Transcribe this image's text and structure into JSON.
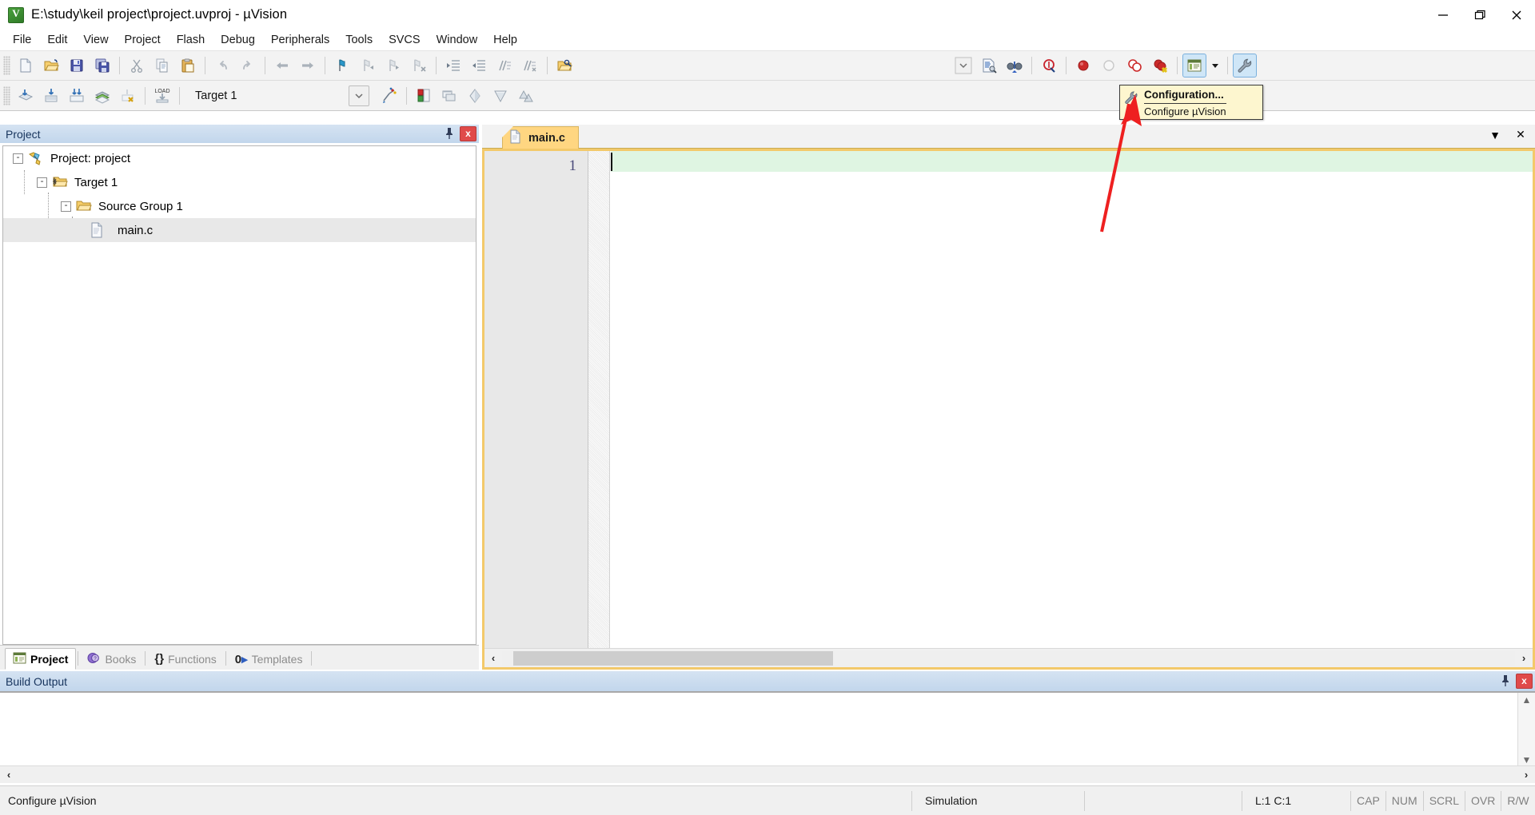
{
  "window": {
    "title": "E:\\study\\keil project\\project.uvproj - µVision",
    "app_icon": "uvision-icon",
    "controls": {
      "minimize": "minimize-icon",
      "restore": "restore-icon",
      "close": "close-icon"
    }
  },
  "menubar": {
    "items": [
      {
        "label": "File"
      },
      {
        "label": "Edit"
      },
      {
        "label": "View"
      },
      {
        "label": "Project"
      },
      {
        "label": "Flash"
      },
      {
        "label": "Debug"
      },
      {
        "label": "Peripherals"
      },
      {
        "label": "Tools"
      },
      {
        "label": "SVCS"
      },
      {
        "label": "Window"
      },
      {
        "label": "Help"
      }
    ]
  },
  "toolbar_main": {
    "buttons": [
      {
        "name": "new-file-icon",
        "tip": "New"
      },
      {
        "name": "open-file-icon",
        "tip": "Open"
      },
      {
        "name": "save-icon",
        "tip": "Save"
      },
      {
        "name": "save-all-icon",
        "tip": "Save All"
      },
      {
        "name": "cut-icon",
        "tip": "Cut"
      },
      {
        "name": "copy-icon",
        "tip": "Copy"
      },
      {
        "name": "paste-icon",
        "tip": "Paste"
      },
      {
        "name": "undo-icon",
        "tip": "Undo"
      },
      {
        "name": "redo-icon",
        "tip": "Redo"
      },
      {
        "name": "navigate-back-icon",
        "tip": "Back"
      },
      {
        "name": "navigate-forward-icon",
        "tip": "Forward"
      },
      {
        "name": "bookmark-toggle-icon",
        "tip": "Insert/Remove Bookmark"
      },
      {
        "name": "bookmark-prev-icon",
        "tip": "Previous Bookmark"
      },
      {
        "name": "bookmark-next-icon",
        "tip": "Next Bookmark"
      },
      {
        "name": "bookmark-clear-icon",
        "tip": "Clear All Bookmarks"
      },
      {
        "name": "indent-icon",
        "tip": "Indent"
      },
      {
        "name": "outdent-icon",
        "tip": "Outdent"
      },
      {
        "name": "comment-icon",
        "tip": "Comment"
      },
      {
        "name": "uncomment-icon",
        "tip": "Uncomment"
      },
      {
        "name": "open-folder-search-icon",
        "tip": "Find in Files"
      },
      {
        "name": "search-history-dropdown-icon",
        "tip": "Search history"
      },
      {
        "name": "find-in-files-icon",
        "tip": "Find in Files"
      },
      {
        "name": "binoculars-icon",
        "tip": "Incremental Find"
      },
      {
        "name": "bookmark-find-icon",
        "tip": "Find"
      },
      {
        "name": "breakpoint-insert-icon",
        "tip": "Insert/Remove Breakpoint"
      },
      {
        "name": "breakpoint-disable-icon",
        "tip": "Enable/Disable Breakpoint"
      },
      {
        "name": "breakpoint-disable-all-icon",
        "tip": "Disable All Breakpoints"
      },
      {
        "name": "breakpoint-kill-all-icon",
        "tip": "Kill All Breakpoints"
      },
      {
        "name": "project-window-icon",
        "tip": "Project Window",
        "active": true
      },
      {
        "name": "project-window-dropdown-icon",
        "tip": "Project Window options"
      },
      {
        "name": "configuration-wrench-icon",
        "tip": "Configuration"
      }
    ]
  },
  "toolbar_build": {
    "buttons": [
      {
        "name": "translate-icon",
        "tip": "Translate"
      },
      {
        "name": "build-icon",
        "tip": "Build"
      },
      {
        "name": "rebuild-icon",
        "tip": "Rebuild"
      },
      {
        "name": "batch-build-icon",
        "tip": "Batch Build"
      },
      {
        "name": "stop-build-icon",
        "tip": "Stop Build"
      },
      {
        "name": "download-icon",
        "tip": "Download",
        "label": "LOAD"
      },
      {
        "name": "target-options-icon",
        "tip": "Options for Target"
      },
      {
        "name": "manage-components-icon",
        "tip": "Manage Project Items"
      },
      {
        "name": "manage-multi-project-icon",
        "tip": "Manage Multi-Project"
      },
      {
        "name": "open-books-icon",
        "tip": "Books"
      },
      {
        "name": "functions-icon",
        "tip": "Functions"
      },
      {
        "name": "templates-icon",
        "tip": "Templates"
      }
    ],
    "target_selector": {
      "value": "Target 1",
      "dropdown_icon": "chevron-down-icon"
    }
  },
  "tooltip": {
    "icon": "configuration-wrench-icon",
    "title": "Configuration...",
    "subtitle": "Configure µVision"
  },
  "project_panel": {
    "header": {
      "title": "Project",
      "pin_icon": "pin-icon",
      "close_icon": "close-icon"
    },
    "tree": [
      {
        "label": "Project: project",
        "level": 0,
        "icon": "project-node-icon",
        "expander": "-"
      },
      {
        "label": "Target 1",
        "level": 1,
        "icon": "target-folder-icon",
        "expander": "-"
      },
      {
        "label": "Source Group 1",
        "level": 2,
        "icon": "folder-icon",
        "expander": "-"
      },
      {
        "label": "main.c",
        "level": 3,
        "icon": "c-file-icon",
        "expander": "",
        "selected": true
      }
    ],
    "tabs": [
      {
        "label": "Project",
        "icon": "project-tab-icon",
        "active": true
      },
      {
        "label": "Books",
        "icon": "books-tab-icon",
        "active": false
      },
      {
        "label": "Functions",
        "icon": "functions-tab-icon",
        "active": false
      },
      {
        "label": "Templates",
        "icon": "templates-tab-icon",
        "active": false
      }
    ]
  },
  "editor": {
    "tab": {
      "label": "main.c",
      "icon": "c-file-icon"
    },
    "tabstrip_buttons": [
      {
        "name": "tab-list-dropdown-icon",
        "glyph": "▼"
      },
      {
        "name": "close-document-icon",
        "glyph": "✕"
      }
    ],
    "line_numbers": [
      "1"
    ],
    "content": "",
    "hscroll": {
      "left_arrow": "‹",
      "right_arrow": "›"
    }
  },
  "build_output": {
    "header": {
      "title": "Build Output",
      "pin_icon": "pin-icon",
      "close_icon": "close-icon"
    },
    "content": "",
    "vscroll": {
      "up_arrow": "▲",
      "down_arrow": "▼"
    },
    "hscroll": {
      "left_arrow": "‹",
      "right_arrow": "›"
    }
  },
  "statusbar": {
    "message": "Configure µVision",
    "simulation": "Simulation",
    "blank": "",
    "cursor": "L:1 C:1",
    "keys": [
      "CAP",
      "NUM",
      "SCRL",
      "OVR",
      "R/W"
    ]
  },
  "colors": {
    "tab_active": "#ffd681",
    "editor_border": "#f3c96a",
    "current_line": "#dff5e2",
    "panel_header": "#c2d6ec",
    "annotation_arrow": "#ee2020",
    "tooltip_bg": "#fdf6cf",
    "close_button": "#e04a4a"
  }
}
